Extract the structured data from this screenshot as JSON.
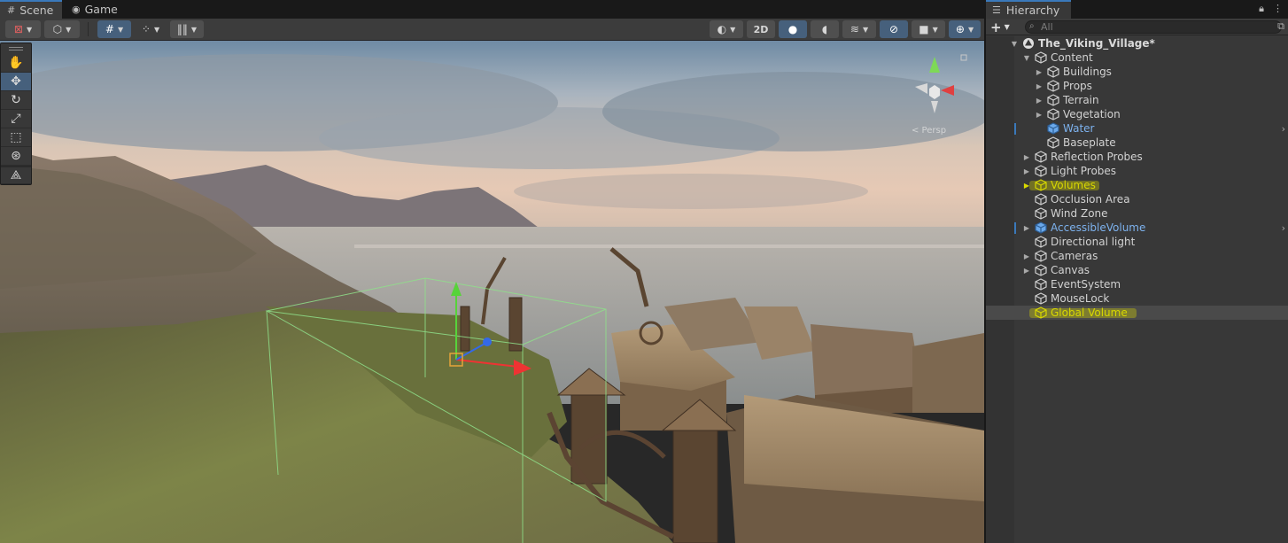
{
  "scene_panel": {
    "tabs": [
      {
        "label": "Scene",
        "icon": "grid-icon",
        "active": true
      },
      {
        "label": "Game",
        "icon": "gamepad-icon",
        "active": false
      }
    ],
    "toolbar": {
      "view_2d_label": "2D"
    },
    "tools": [
      "hand-tool",
      "move-tool",
      "rotate-tool",
      "scale-tool",
      "rect-tool",
      "transform-tool",
      "custom-tool"
    ],
    "gizmo": {
      "persp_label": "< Persp"
    }
  },
  "hierarchy": {
    "tab_label": "Hierarchy",
    "search_placeholder": "All",
    "items": [
      {
        "label": "The_Viking_Village*",
        "depth": 0,
        "arrow": "open",
        "type": "scene"
      },
      {
        "label": "Content",
        "depth": 1,
        "arrow": "open",
        "type": "object"
      },
      {
        "label": "Buildings",
        "depth": 2,
        "arrow": "closed",
        "type": "object"
      },
      {
        "label": "Props",
        "depth": 2,
        "arrow": "closed",
        "type": "object"
      },
      {
        "label": "Terrain",
        "depth": 2,
        "arrow": "closed",
        "type": "object"
      },
      {
        "label": "Vegetation",
        "depth": 2,
        "arrow": "closed",
        "type": "object"
      },
      {
        "label": "Water",
        "depth": 2,
        "arrow": "none",
        "type": "prefab"
      },
      {
        "label": "Baseplate",
        "depth": 2,
        "arrow": "none",
        "type": "object"
      },
      {
        "label": "Reflection Probes",
        "depth": 1,
        "arrow": "closed",
        "type": "object"
      },
      {
        "label": "Light Probes",
        "depth": 1,
        "arrow": "closed",
        "type": "object"
      },
      {
        "label": "Volumes",
        "depth": 1,
        "arrow": "closed",
        "type": "highlighted"
      },
      {
        "label": "Occlusion Area",
        "depth": 1,
        "arrow": "none",
        "type": "object"
      },
      {
        "label": "Wind Zone",
        "depth": 1,
        "arrow": "none",
        "type": "object"
      },
      {
        "label": "AccessibleVolume",
        "depth": 1,
        "arrow": "closed",
        "type": "prefab"
      },
      {
        "label": "Directional light",
        "depth": 1,
        "arrow": "none",
        "type": "object"
      },
      {
        "label": "Cameras",
        "depth": 1,
        "arrow": "closed",
        "type": "object"
      },
      {
        "label": "Canvas",
        "depth": 1,
        "arrow": "closed",
        "type": "object"
      },
      {
        "label": "EventSystem",
        "depth": 1,
        "arrow": "none",
        "type": "object"
      },
      {
        "label": "MouseLock",
        "depth": 1,
        "arrow": "none",
        "type": "object"
      },
      {
        "label": "Global Volume",
        "depth": 1,
        "arrow": "none",
        "type": "highlighted-selected"
      }
    ]
  },
  "colors": {
    "accent": "#3a79bb",
    "prefab_text": "#7db2ee",
    "highlight": "#ded900"
  }
}
